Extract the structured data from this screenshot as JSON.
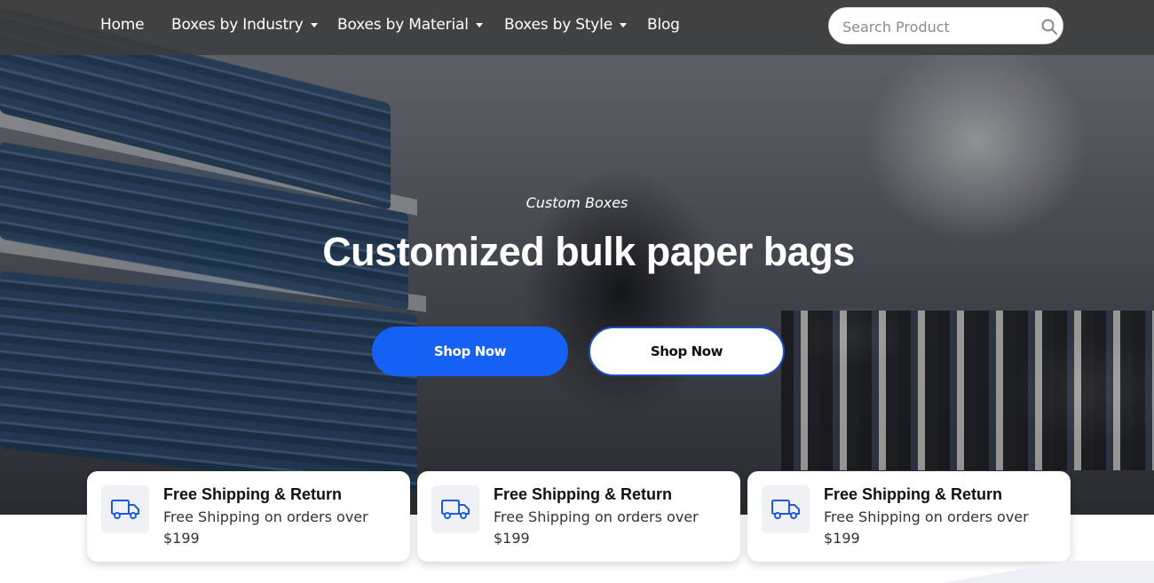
{
  "nav": {
    "items": [
      {
        "label": "Home",
        "has_dropdown": false
      },
      {
        "label": "Boxes by Industry",
        "has_dropdown": true
      },
      {
        "label": "Boxes by Material",
        "has_dropdown": true
      },
      {
        "label": "Boxes by Style",
        "has_dropdown": true
      },
      {
        "label": "Blog",
        "has_dropdown": false
      }
    ],
    "search": {
      "placeholder": "Search Product",
      "value": "",
      "icon": "search-icon"
    }
  },
  "hero": {
    "eyebrow": "Custom Boxes",
    "headline": "Customized bulk paper bags",
    "buttons": {
      "primary_label": "Shop Now",
      "secondary_label": "Shop Now"
    }
  },
  "features": [
    {
      "icon": "truck-icon",
      "title": "Free Shipping & Return",
      "description": "Free Shipping on orders over $199"
    },
    {
      "icon": "truck-icon",
      "title": "Free Shipping & Return",
      "description": "Free Shipping on orders over $199"
    },
    {
      "icon": "truck-icon",
      "title": "Free Shipping & Return",
      "description": "Free Shipping on orders over $199"
    }
  ],
  "colors": {
    "accent": "#1560f5",
    "navbar": "#3c3c3c",
    "icon_blue": "#1f5bd8"
  }
}
